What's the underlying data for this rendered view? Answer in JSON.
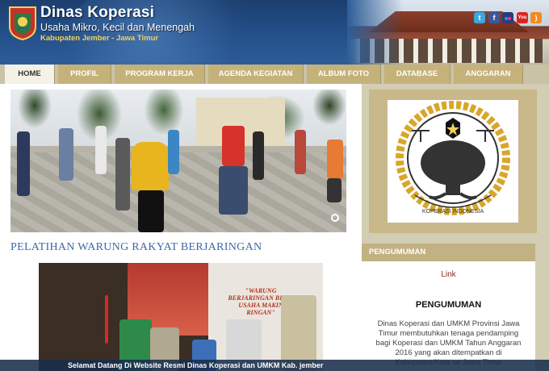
{
  "header": {
    "title": "Dinas Koperasi",
    "subtitle": "Usaha Mikro, Kecil dan Menengah",
    "location": "Kabupaten Jember - Jawa Timur",
    "social_icons": [
      "twitter-icon",
      "facebook-icon",
      "flickr-icon",
      "youtube-icon",
      "rss-icon"
    ]
  },
  "nav": {
    "items": [
      {
        "label": "HOME"
      },
      {
        "label": "PROFIL"
      },
      {
        "label": "PROGRAM KERJA"
      },
      {
        "label": "AGENDA KEGIATAN"
      },
      {
        "label": "ALBUM FOTO"
      },
      {
        "label": "DATABASE"
      },
      {
        "label": "ANGGARAN"
      }
    ]
  },
  "main": {
    "news_title": "PELATIHAN WARUNG RAKYAT BERJARINGAN",
    "banner_text": "\"WARUNG BERJARINGAN BIKIN USAHA MAKIN RINGAN\""
  },
  "sidebar": {
    "logo_text": "KOPERASI INDONESIA",
    "pengumuman_header": "PENGUMUMAN",
    "link_label": "Link",
    "pengumuman_title": "PENGUMUMAN",
    "pengumuman_text": "Dinas Koperasi dan UMKM Provinsi Jawa Timur membutuhkan tenaga pendamping bagi Koperasi dan UMKM Tahun Anggaran 2016 yang akan ditempatkan di Kabupaten/Kota se Jawa Timur"
  },
  "ticker": "Selamat Datang Di Website Resmi Dinas Koperasi dan UMKM Kab. jember",
  "colors": {
    "header_blue": "#24508a",
    "nav_gold": "#c4b27a",
    "title_blue": "#3b6aa5",
    "location_yellow": "#f3d25a"
  }
}
